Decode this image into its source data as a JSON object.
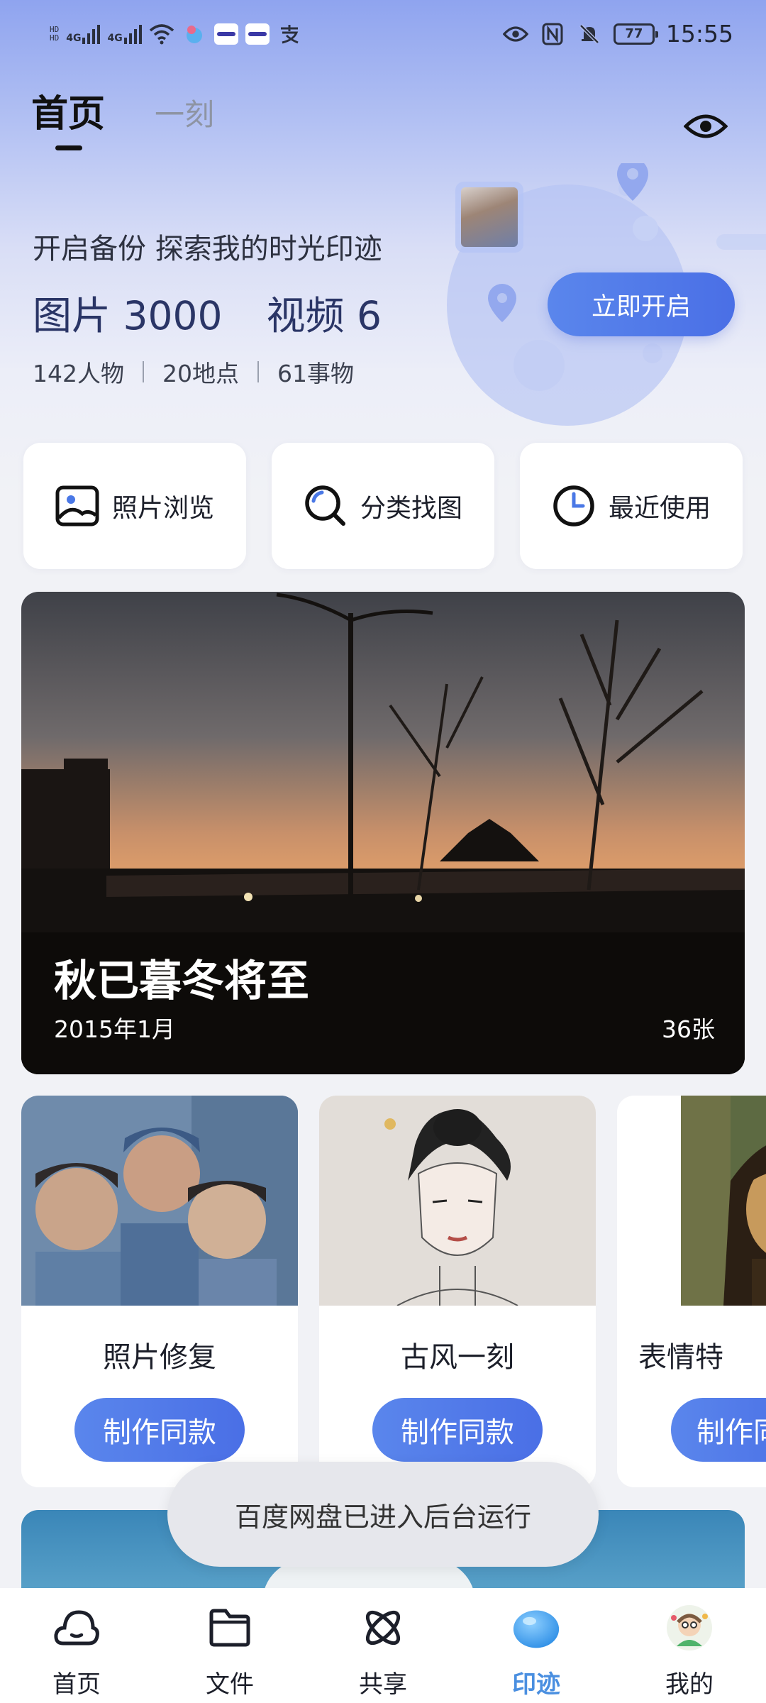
{
  "status_bar": {
    "hd_top": "HD",
    "hd_bottom": "HD",
    "network_1": "4G",
    "network_2": "4G",
    "battery": "77",
    "time": "15:55",
    "icons": [
      "signal-icon",
      "signal-icon",
      "wifi-icon",
      "app-notification-icon",
      "app-notification-icon",
      "app-notification-icon",
      "alipay-icon",
      "eye-icon",
      "nfc-icon",
      "mute-bell-icon",
      "battery-icon"
    ]
  },
  "header": {
    "tabs": [
      {
        "label": "首页",
        "active": true
      },
      {
        "label": "一刻",
        "active": false
      }
    ],
    "privacy_icon": "eye-icon"
  },
  "hero": {
    "backup_prompt": "开启备份 探索我的时光印迹",
    "photos_label": "图片 3000",
    "videos_label": "视频 6",
    "people": "142人物",
    "places": "20地点",
    "things": "61事物",
    "enable_button": "立即开启"
  },
  "quick_actions": [
    {
      "label": "照片浏览",
      "icon": "photo-browse-icon"
    },
    {
      "label": "分类找图",
      "icon": "category-search-icon"
    },
    {
      "label": "最近使用",
      "icon": "clock-icon"
    }
  ],
  "memory_card": {
    "title": "秋已暮冬将至",
    "date": "2015年1月",
    "count": "36张"
  },
  "templates": [
    {
      "name": "照片修复",
      "button": "制作同款"
    },
    {
      "name": "古风一刻",
      "button": "制作同款"
    },
    {
      "name": "表情特",
      "button": "制作同"
    }
  ],
  "toast": "百度网盘已进入后台运行",
  "bottom_nav": [
    {
      "label": "首页",
      "icon": "cloud-home-icon",
      "active": false
    },
    {
      "label": "文件",
      "icon": "folder-icon",
      "active": false
    },
    {
      "label": "共享",
      "icon": "atom-share-icon",
      "active": false
    },
    {
      "label": "印迹",
      "icon": "blue-orb-icon",
      "active": true
    },
    {
      "label": "我的",
      "icon": "avatar-icon",
      "active": false
    }
  ],
  "colors": {
    "accent": "#4a6fe6",
    "active_nav": "#4a8fe0",
    "hero_top": "#8fa4ef"
  }
}
